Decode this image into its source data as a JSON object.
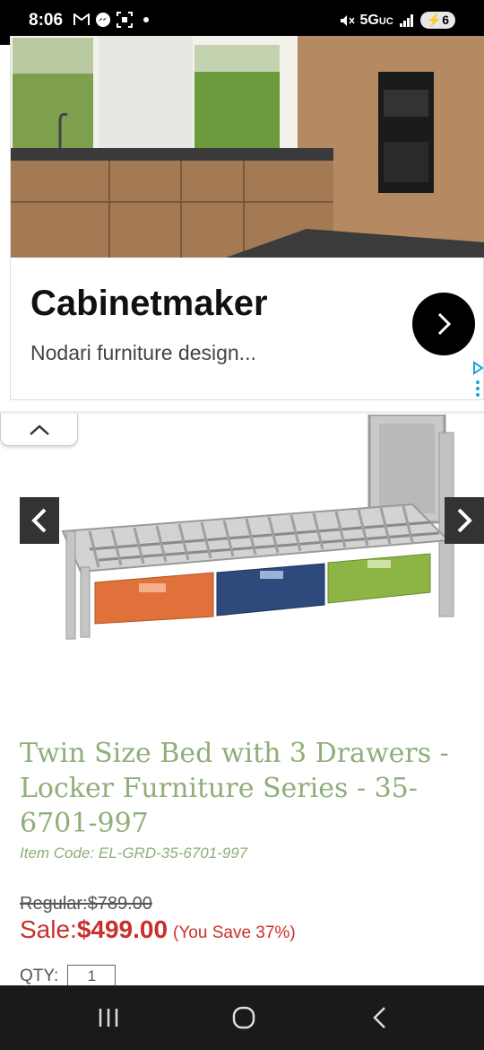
{
  "status_bar": {
    "time": "8:06",
    "network": "5G",
    "network_sub": "UC",
    "battery": "6"
  },
  "ad": {
    "title": "Cabinetmaker",
    "subtitle": "Nodari furniture design..."
  },
  "product": {
    "title": "Twin Size Bed with 3 Drawers - Locker Furniture Series - 35-6701-997",
    "item_code": "Item Code: EL-GRD-35-6701-997",
    "regular_price": "Regular:$789.00",
    "sale_label": "Sale:",
    "sale_price": "$499.00",
    "savings": "(You Save 37%)",
    "qty_label": "QTY:",
    "qty_value": "1",
    "drawer_colors": [
      "#e0713a",
      "#2e4a7c",
      "#8cb545"
    ]
  },
  "colors": {
    "title_green": "#8fae7a",
    "sale_red": "#c9302c"
  },
  "icons": {
    "collapse": "chevron-up-icon",
    "prev": "chevron-left-icon",
    "next": "chevron-right-icon",
    "ad_arrow": "chevron-right-icon",
    "nav_recents": "recents-icon",
    "nav_home": "home-icon",
    "nav_back": "back-icon"
  }
}
